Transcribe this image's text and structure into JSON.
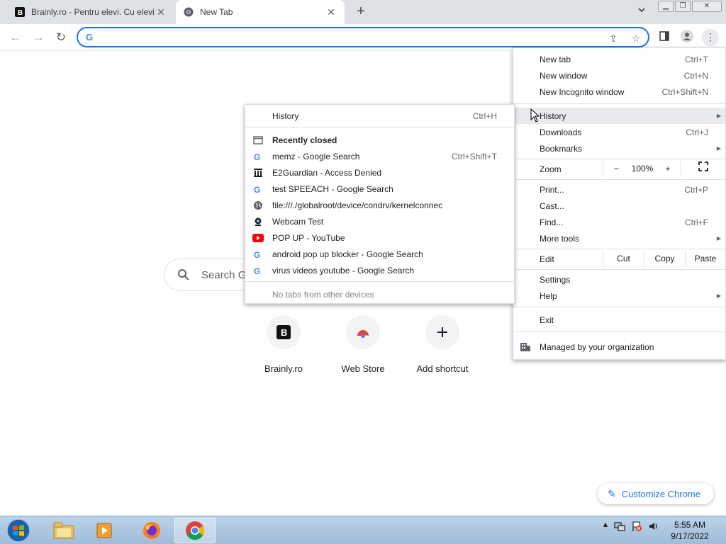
{
  "tabs": [
    {
      "title": "Brainly.ro - Pentru elevi. Cu elevi."
    },
    {
      "title": "New Tab"
    }
  ],
  "omnibox": {
    "value": ""
  },
  "ntp": {
    "search_placeholder": "Search G",
    "shortcuts": [
      {
        "label": "Brainly.ro"
      },
      {
        "label": "Web Store"
      },
      {
        "label": "Add shortcut"
      }
    ],
    "customize_label": "Customize Chrome"
  },
  "menu": {
    "new_tab": {
      "label": "New tab",
      "shortcut": "Ctrl+T"
    },
    "new_window": {
      "label": "New window",
      "shortcut": "Ctrl+N"
    },
    "new_incognito": {
      "label": "New Incognito window",
      "shortcut": "Ctrl+Shift+N"
    },
    "history": {
      "label": "History"
    },
    "downloads": {
      "label": "Downloads",
      "shortcut": "Ctrl+J"
    },
    "bookmarks": {
      "label": "Bookmarks"
    },
    "zoom": {
      "label": "Zoom",
      "minus": "−",
      "level": "100%",
      "plus": "+"
    },
    "print": {
      "label": "Print...",
      "shortcut": "Ctrl+P"
    },
    "cast": {
      "label": "Cast..."
    },
    "find": {
      "label": "Find...",
      "shortcut": "Ctrl+F"
    },
    "more_tools": {
      "label": "More tools"
    },
    "edit": {
      "label": "Edit",
      "cut": "Cut",
      "copy": "Copy",
      "paste": "Paste"
    },
    "settings": {
      "label": "Settings"
    },
    "help": {
      "label": "Help"
    },
    "exit": {
      "label": "Exit"
    },
    "managed": {
      "label": "Managed by your organization"
    }
  },
  "history_menu": {
    "history": {
      "label": "History",
      "shortcut": "Ctrl+H"
    },
    "recently_closed": {
      "label": "Recently closed"
    },
    "items": [
      {
        "label": "memz - Google Search",
        "shortcut": "Ctrl+Shift+T",
        "icon": "google-icon"
      },
      {
        "label": "E2Guardian - Access Denied",
        "shortcut": "",
        "icon": "bank-icon"
      },
      {
        "label": "test SPEEACH - Google Search",
        "shortcut": "",
        "icon": "google-icon"
      },
      {
        "label": "file:///./globalroot/device/condrv/kernelconnec",
        "shortcut": "",
        "icon": "globe-icon"
      },
      {
        "label": "Webcam Test",
        "shortcut": "",
        "icon": "webcam-icon"
      },
      {
        "label": "POP UP - YouTube",
        "shortcut": "",
        "icon": "youtube-icon"
      },
      {
        "label": "android pop up blocker - Google Search",
        "shortcut": "",
        "icon": "google-icon"
      },
      {
        "label": "virus videos youtube - Google Search",
        "shortcut": "",
        "icon": "google-icon"
      }
    ],
    "no_tabs": {
      "label": "No tabs from other devices"
    }
  },
  "taskbar": {
    "time": "5:55 AM",
    "date": "9/17/2022"
  },
  "colors": {
    "accent": "#1a73e8",
    "menu_highlight": "#e8eaed",
    "tabstrip": "#dee1e6"
  }
}
